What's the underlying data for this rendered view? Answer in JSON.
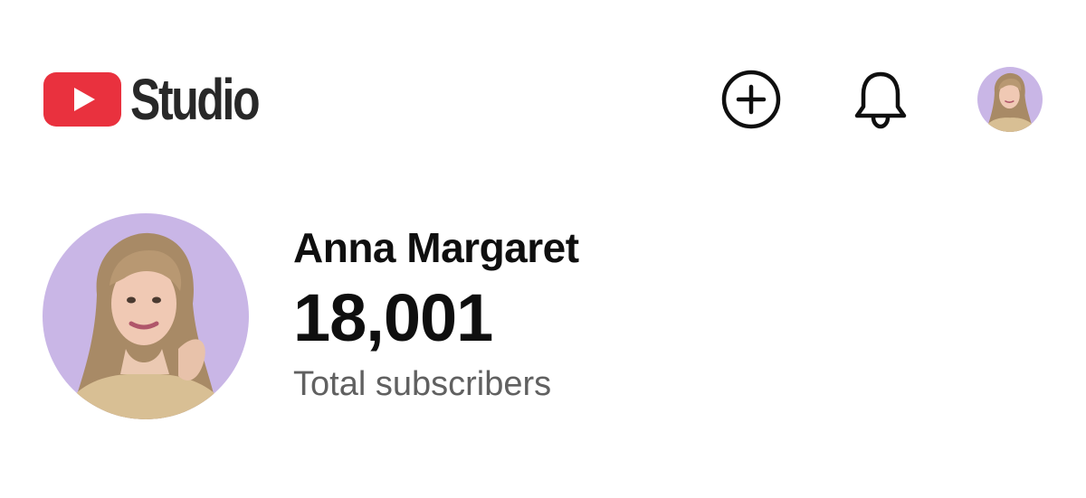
{
  "header": {
    "logo_text": "Studio",
    "logo_icon": "youtube-play-icon",
    "create_icon": "plus-circle-icon",
    "notifications_icon": "bell-icon",
    "brand_color": "#e9313e"
  },
  "channel": {
    "name": "Anna Margaret",
    "subscriber_count": "18,001",
    "subscriber_label": "Total subscribers",
    "avatar_background": "#c9b6e6"
  }
}
